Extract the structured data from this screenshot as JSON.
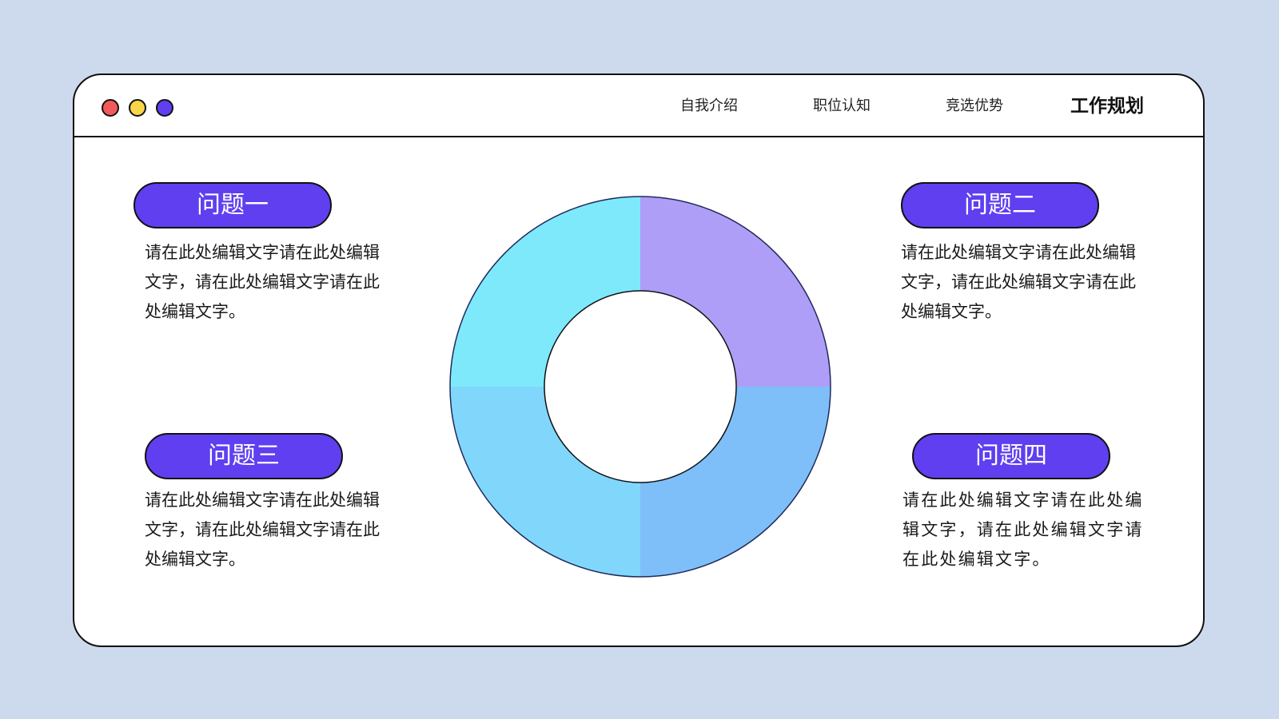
{
  "window": {
    "dots": [
      {
        "name": "close-dot",
        "color": "#f25a5a"
      },
      {
        "name": "minimize-dot",
        "color": "#f8d54a"
      },
      {
        "name": "zoom-dot",
        "color": "#5f3ff0"
      }
    ]
  },
  "nav": {
    "items": [
      {
        "label": "自我介绍",
        "active": false
      },
      {
        "label": "职位认知",
        "active": false
      },
      {
        "label": "竞选优势",
        "active": false
      },
      {
        "label": "工作规划",
        "active": true
      }
    ]
  },
  "accent_color": "#5f3ff0",
  "questions": [
    {
      "title": "问题一",
      "text": "请在此处编辑文字请在此处编辑文字，请在此处编辑文字请在此处编辑文字。"
    },
    {
      "title": "问题二",
      "text": "请在此处编辑文字请在此处编辑文字，请在此处编辑文字请在此处编辑文字。"
    },
    {
      "title": "问题三",
      "text": "请在此处编辑文字请在此处编辑文字，请在此处编辑文字请在此处编辑文字。"
    },
    {
      "title": "问题四",
      "text": "请在此处编辑文字请在此处编辑文字，请在此处编辑文字请在此处编辑文字。"
    }
  ],
  "donut": {
    "segments": [
      {
        "value": 25,
        "color": "#ae9ef7"
      },
      {
        "value": 25,
        "color": "#7ebff9"
      },
      {
        "value": 25,
        "color": "#80d7fb"
      },
      {
        "value": 25,
        "color": "#7fe9fc"
      }
    ]
  }
}
